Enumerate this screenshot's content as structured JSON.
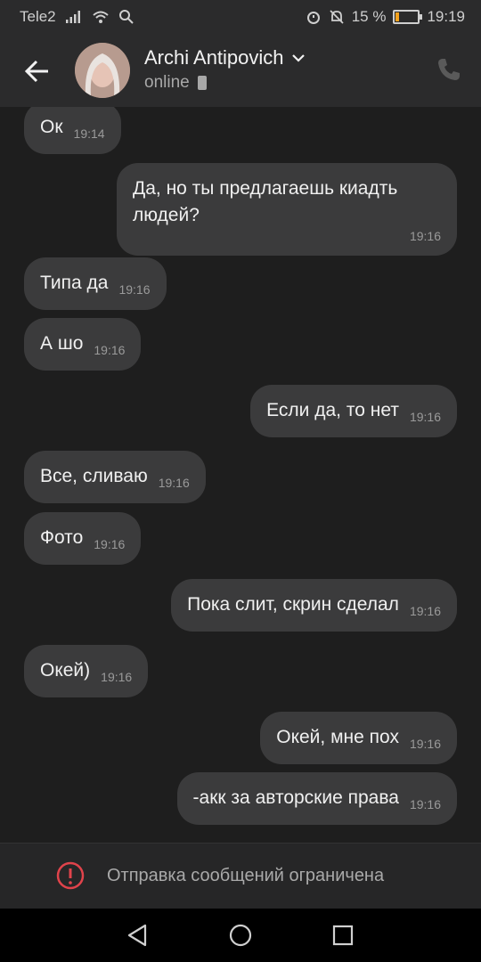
{
  "status_bar": {
    "carrier": "Tele2",
    "battery": "15 %",
    "time": "19:19",
    "battery_level": 0.15
  },
  "header": {
    "contact_name": "Archi Antipovich",
    "status": "online"
  },
  "messages": [
    {
      "dir": "in",
      "text": "Ок",
      "time": "19:14"
    },
    {
      "dir": "out",
      "text": "Да, но ты предлагаешь киадть людей?",
      "time": "19:16"
    },
    {
      "dir": "in",
      "text": "Типа да",
      "time": "19:16"
    },
    {
      "dir": "in",
      "text": "А шо",
      "time": "19:16"
    },
    {
      "dir": "out",
      "text": "Если да, то нет",
      "time": "19:16"
    },
    {
      "dir": "in",
      "text": "Все, сливаю",
      "time": "19:16"
    },
    {
      "dir": "in",
      "text": "Фото",
      "time": "19:16"
    },
    {
      "dir": "out",
      "text": "Пока слит, скрин сделал",
      "time": "19:16"
    },
    {
      "dir": "in",
      "text": "Окей)",
      "time": "19:16"
    },
    {
      "dir": "out",
      "text": "Окей, мне пох",
      "time": "19:16"
    },
    {
      "dir": "out",
      "text": "-акк за авторские права",
      "time": "19:16"
    }
  ],
  "restriction": {
    "text": "Отправка сообщений ограничена"
  },
  "icons": {
    "back": "arrow-left-icon",
    "dropdown": "chevron-down-icon",
    "device": "phone-device-icon",
    "call": "phone-icon",
    "warning": "exclamation-circle-icon",
    "nav_back": "triangle-back-icon",
    "nav_home": "circle-home-icon",
    "nav_recent": "square-recent-icon"
  },
  "colors": {
    "background": "#1e1e1e",
    "bubble": "#3b3b3c",
    "warning": "#e0434b",
    "battery": "#f4a21d"
  }
}
